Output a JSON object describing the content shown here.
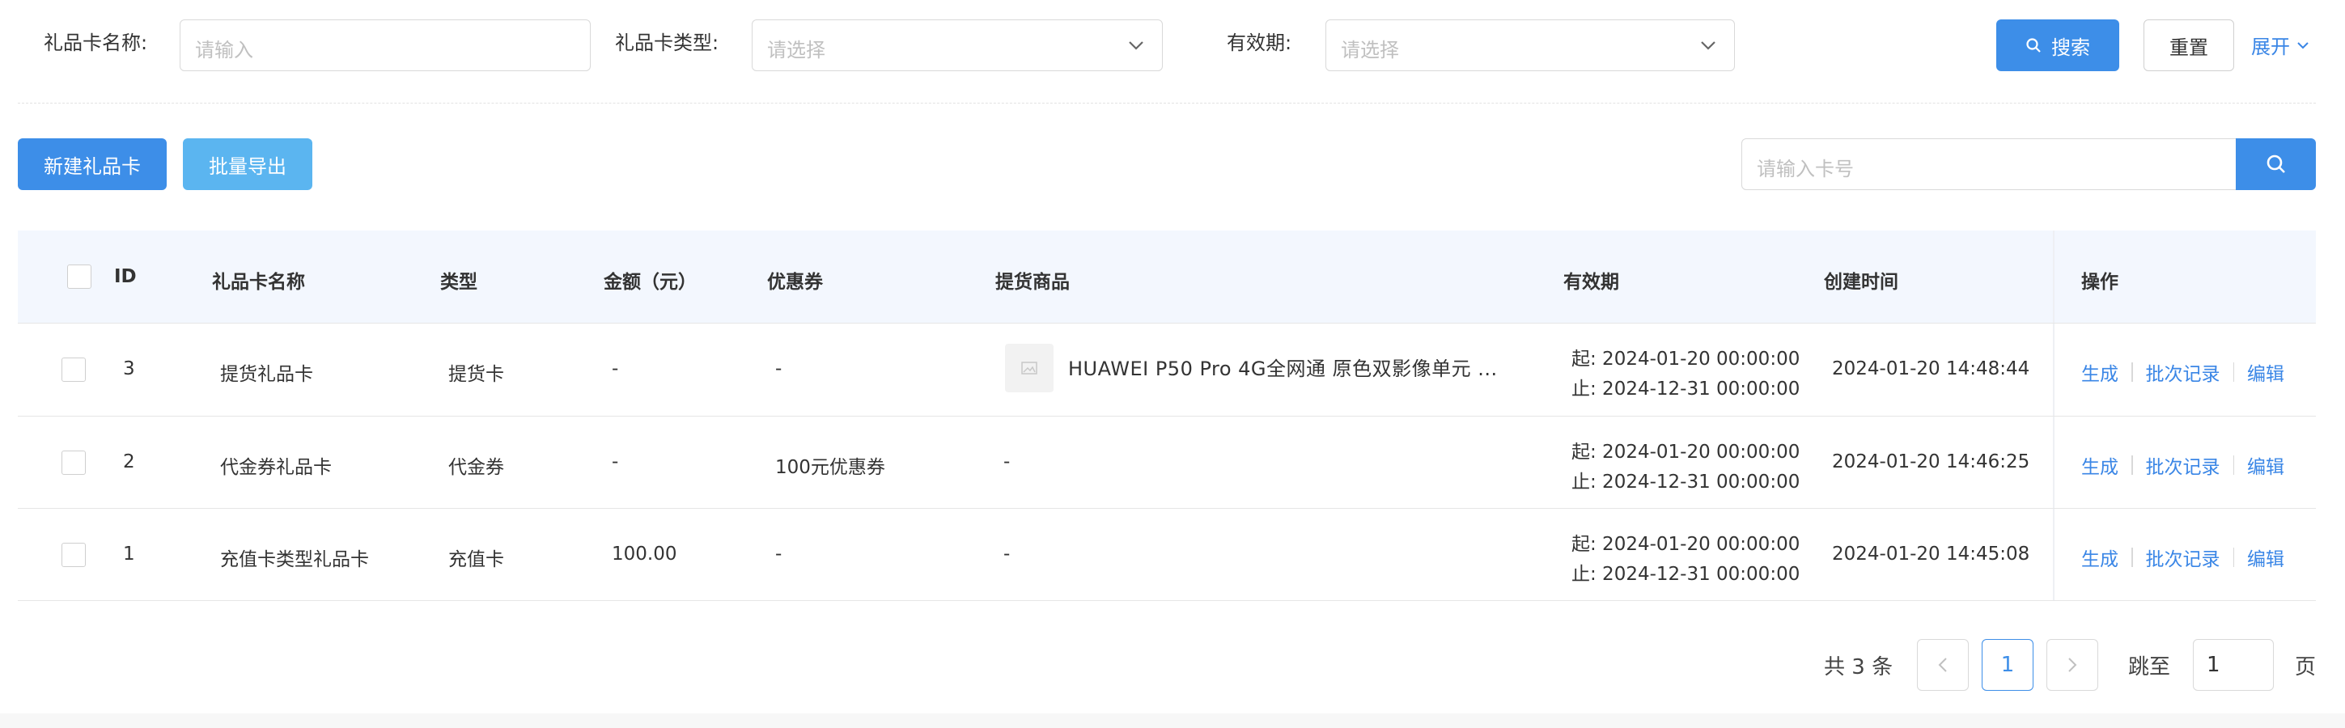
{
  "filters": {
    "name_label": "礼品卡名称:",
    "name_placeholder": "请输入",
    "type_label": "礼品卡类型:",
    "type_placeholder": "请选择",
    "validity_label": "有效期:",
    "validity_placeholder": "请选择",
    "search_label": "搜索",
    "reset_label": "重置",
    "expand_label": "展开"
  },
  "toolbar": {
    "new_label": "新建礼品卡",
    "export_label": "批量导出",
    "card_search_placeholder": "请输入卡号"
  },
  "table": {
    "columns": [
      "ID",
      "礼品卡名称",
      "类型",
      "金额（元）",
      "优惠券",
      "提货商品",
      "有效期",
      "创建时间",
      "操作"
    ],
    "rows": [
      {
        "id": "3",
        "name": "提货礼品卡",
        "type": "提货卡",
        "amount": "-",
        "coupon": "-",
        "product": "HUAWEI P50 Pro 4G全网通 原色双影像单元 ...",
        "start": "起: 2024-01-20 00:00:00",
        "end": "止: 2024-12-31 00:00:00",
        "created": "2024-01-20 14:48:44"
      },
      {
        "id": "2",
        "name": "代金券礼品卡",
        "type": "代金券",
        "amount": "-",
        "coupon": "100元优惠券",
        "product": "-",
        "start": "起: 2024-01-20 00:00:00",
        "end": "止: 2024-12-31 00:00:00",
        "created": "2024-01-20 14:46:25"
      },
      {
        "id": "1",
        "name": "充值卡类型礼品卡",
        "type": "充值卡",
        "amount": "100.00",
        "coupon": "-",
        "product": "-",
        "start": "起: 2024-01-20 00:00:00",
        "end": "止: 2024-12-31 00:00:00",
        "created": "2024-01-20 14:45:08"
      }
    ],
    "actions": [
      "生成",
      "批次记录",
      "编辑"
    ]
  },
  "pagination": {
    "total_text": "共 3 条",
    "current_page": "1",
    "jump_label": "跳至",
    "jump_value": "1",
    "page_suffix": "页"
  },
  "colors": {
    "primary": "#3d8ee8",
    "light_button": "#5bb5f0",
    "link": "#3a86e6",
    "header_bg": "#f3f7fe"
  }
}
